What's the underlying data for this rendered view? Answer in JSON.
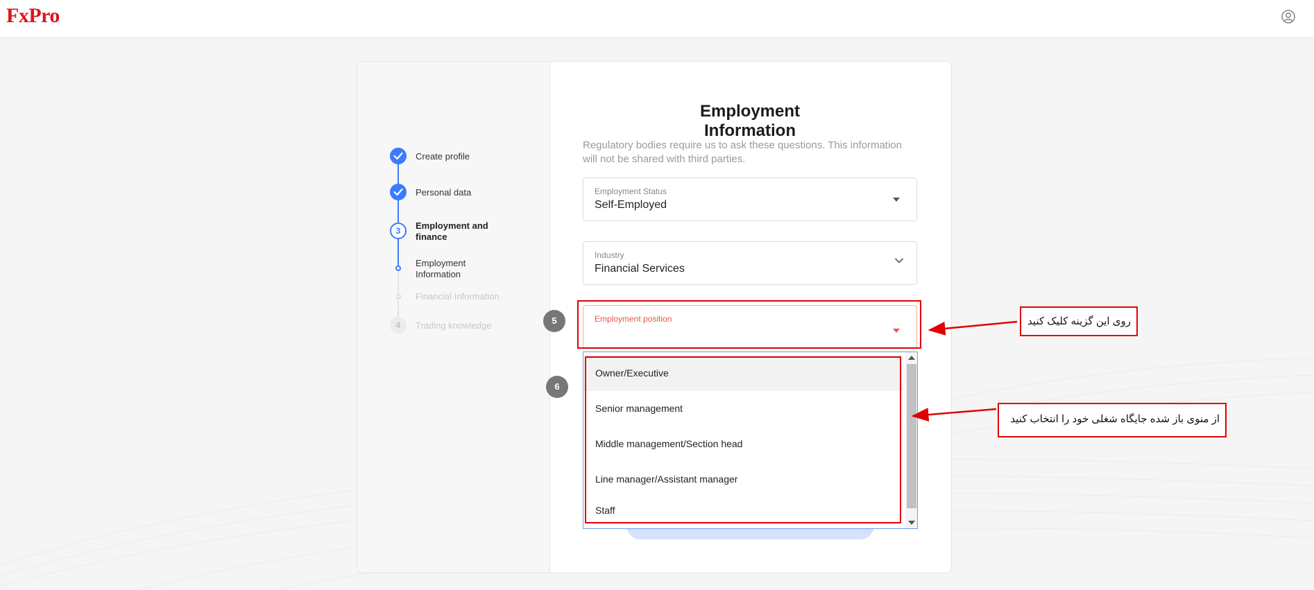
{
  "header": {
    "logo": "FxPro",
    "user_icon": "user-circle-icon"
  },
  "stepper": {
    "steps": [
      {
        "label": "Create profile",
        "state": "done"
      },
      {
        "label": "Personal data",
        "state": "done"
      },
      {
        "number": "3",
        "label": "Employment and finance",
        "state": "active"
      },
      {
        "number": "4",
        "label": "Trading knowledge",
        "state": "pending"
      }
    ],
    "substeps": [
      {
        "label": "Employment Information",
        "state": "active"
      },
      {
        "label": "Financial Information",
        "state": "pending"
      }
    ]
  },
  "form": {
    "title": "Employment Information",
    "subtitle": "Regulatory bodies require us to ask these questions. This information will not be shared with third parties.",
    "employment_status": {
      "label": "Employment Status",
      "value": "Self-Employed"
    },
    "industry": {
      "label": "Industry",
      "value": "Financial Services"
    },
    "employment_position": {
      "label": "Employment position",
      "value": ""
    },
    "dropdown_options": [
      "Owner/Executive",
      "Senior management",
      "Middle management/Section head",
      "Line manager/Assistant manager",
      "Staff"
    ]
  },
  "annotations": {
    "badge_5": "5",
    "badge_6": "6",
    "note_5": "روی این گزینه کلیک کنید",
    "note_6": "از منوی باز شده جایگاه شغلی خود را انتخاب کنید",
    "color": "#e00000"
  },
  "colors": {
    "brand": "#e0141e",
    "accent": "#3a7bff",
    "error": "#e8584a"
  }
}
